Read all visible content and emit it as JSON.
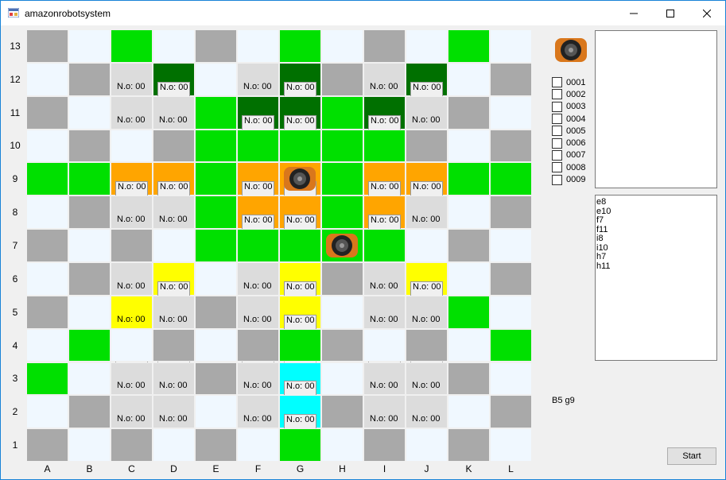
{
  "window": {
    "title": "amazonrobotsystem",
    "minimize_icon": "minimize-icon",
    "maximize_icon": "maximize-icon",
    "close_icon": "close-icon"
  },
  "board": {
    "columns": [
      "A",
      "B",
      "C",
      "D",
      "E",
      "F",
      "G",
      "H",
      "I",
      "J",
      "K",
      "L"
    ],
    "rows": [
      "13",
      "12",
      "11",
      "10",
      "9",
      "8",
      "7",
      "6",
      "5",
      "4",
      "3",
      "2",
      "1"
    ],
    "colors": {
      "g": "#a9a9a9",
      "w": "#f0f8ff",
      "G": "#00e000",
      "D": "#007000",
      "L": "#dcdcdc",
      "O": "#ffa500",
      "Y": "#ffff00",
      "C": "#00ffff"
    },
    "cell_label": "N.o: 00",
    "cells": [
      [
        "g",
        "w",
        "G",
        "w",
        "g",
        "w",
        "G",
        "w",
        "g",
        "w",
        "G",
        "w"
      ],
      [
        "w",
        "g",
        "L",
        "D",
        "w",
        "L",
        "D",
        "g",
        "L",
        "D",
        "w",
        "g"
      ],
      [
        "g",
        "w",
        "L",
        "L",
        "G",
        "D",
        "D",
        "G",
        "D",
        "L",
        "g",
        "w"
      ],
      [
        "w",
        "g",
        "w",
        "g",
        "G",
        "G",
        "G",
        "G",
        "G",
        "g",
        "w",
        "g"
      ],
      [
        "G",
        "G",
        "O",
        "O",
        "G",
        "O",
        "O",
        "G",
        "O",
        "O",
        "G",
        "G"
      ],
      [
        "w",
        "g",
        "L",
        "L",
        "G",
        "O",
        "O",
        "G",
        "O",
        "L",
        "w",
        "g"
      ],
      [
        "g",
        "w",
        "g",
        "w",
        "G",
        "G",
        "G",
        "G",
        "G",
        "w",
        "g",
        "w"
      ],
      [
        "w",
        "g",
        "L",
        "Y",
        "w",
        "L",
        "Y",
        "g",
        "L",
        "Y",
        "w",
        "g"
      ],
      [
        "g",
        "w",
        "Y",
        "L",
        "g",
        "L",
        "Y",
        "w",
        "L",
        "L",
        "G",
        "w"
      ],
      [
        "w",
        "G",
        "w",
        "g",
        "w",
        "g",
        "G",
        "g",
        "w",
        "g",
        "w",
        "G"
      ],
      [
        "G",
        "w",
        "L",
        "L",
        "g",
        "L",
        "C",
        "w",
        "L",
        "L",
        "g",
        "w"
      ],
      [
        "w",
        "g",
        "L",
        "L",
        "w",
        "L",
        "C",
        "g",
        "L",
        "L",
        "w",
        "g"
      ],
      [
        "g",
        "w",
        "g",
        "w",
        "g",
        "w",
        "G",
        "w",
        "g",
        "w",
        "g",
        "w"
      ]
    ],
    "labels": [
      [],
      [
        [
          2,
          false
        ],
        [
          3,
          true
        ],
        [
          5,
          false
        ],
        [
          6,
          true
        ],
        [
          8,
          false
        ],
        [
          9,
          true
        ]
      ],
      [
        [
          2,
          false
        ],
        [
          3,
          false
        ],
        [
          5,
          true
        ],
        [
          6,
          true
        ],
        [
          8,
          true
        ],
        [
          9,
          false
        ]
      ],
      [],
      [
        [
          2,
          true
        ],
        [
          3,
          true
        ],
        [
          5,
          true
        ],
        [
          6,
          true
        ],
        [
          8,
          true
        ],
        [
          9,
          true
        ]
      ],
      [
        [
          2,
          false
        ],
        [
          3,
          false
        ],
        [
          5,
          true
        ],
        [
          6,
          true
        ],
        [
          8,
          true
        ],
        [
          9,
          false
        ]
      ],
      [],
      [
        [
          2,
          false
        ],
        [
          3,
          true
        ],
        [
          5,
          false
        ],
        [
          6,
          true
        ],
        [
          8,
          false
        ],
        [
          9,
          true
        ]
      ],
      [
        [
          2,
          false
        ],
        [
          3,
          false
        ],
        [
          5,
          false
        ],
        [
          6,
          true
        ],
        [
          8,
          false
        ],
        [
          9,
          false
        ]
      ],
      [],
      [
        [
          2,
          false
        ],
        [
          3,
          false
        ],
        [
          5,
          false
        ],
        [
          6,
          true
        ],
        [
          8,
          false
        ],
        [
          9,
          false
        ]
      ],
      [
        [
          2,
          false
        ],
        [
          3,
          false
        ],
        [
          5,
          false
        ],
        [
          6,
          true
        ],
        [
          8,
          false
        ],
        [
          9,
          false
        ]
      ],
      []
    ],
    "robots": [
      {
        "col": 6,
        "row": 4
      },
      {
        "col": 7,
        "row": 6
      }
    ]
  },
  "checklist": [
    "0001",
    "0002",
    "0003",
    "0004",
    "0005",
    "0006",
    "0007",
    "0008",
    "0009"
  ],
  "positions_list": [
    "e8",
    "e10",
    "f7",
    "f11",
    "i8",
    "i10",
    "h7",
    "h11"
  ],
  "status_text": "B5 g9",
  "start_button_label": "Start"
}
